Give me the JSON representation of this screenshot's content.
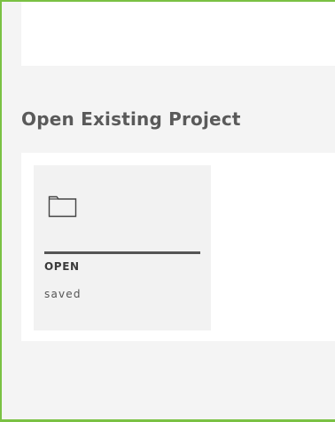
{
  "section": {
    "title": "Open Existing Project"
  },
  "project_card": {
    "icon": "folder-icon",
    "title": "OPEN",
    "subtitle": "saved"
  },
  "colors": {
    "frame_border": "#7ac143",
    "page_background": "#f4f4f4",
    "panel_background": "#ffffff",
    "card_background": "#f2f2f2",
    "heading_text": "#5a5a5a",
    "card_rule": "#555555"
  }
}
